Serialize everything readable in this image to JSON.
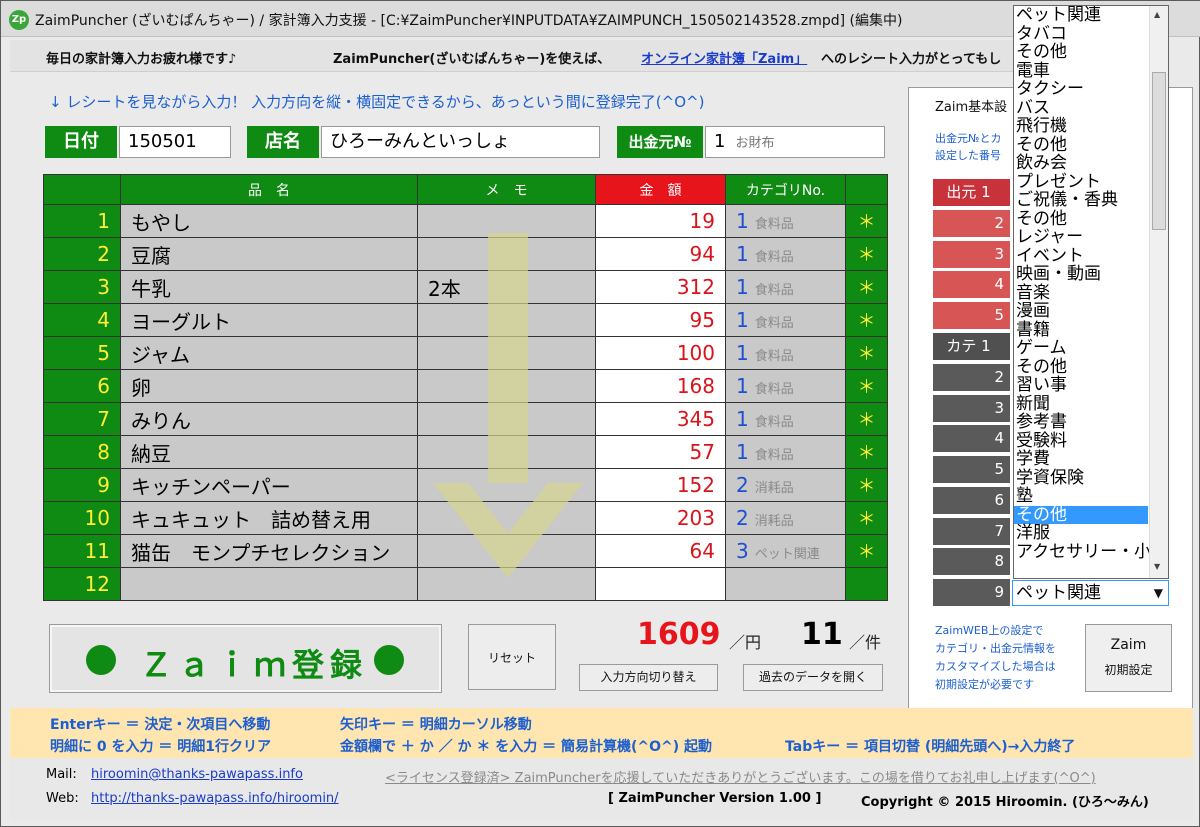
{
  "window": {
    "icon_text": "Zp",
    "title": "ZaimPuncher (ざいむぱんちゃー) / 家計簿入力支援 - [C:¥ZaimPuncher¥INPUTDATA¥ZAIMPUNCH_150502143528.zmpd] (編集中)"
  },
  "banner": {
    "greeting": "毎日の家計簿入力お疲れ様です♪",
    "msg1": "ZaimPuncher(ざいむぱんちゃー)を使えば、",
    "link": "オンライン家計簿「Zaim」",
    "msg2": "へのレシート入力がとってもし"
  },
  "lead": "↓ レシートを見ながら入力！ 入力方向を縦・横固定できるから、あっという間に登録完了(^O^)",
  "header_fields": {
    "date_label": "日付",
    "date_value": "150501",
    "shop_label": "店名",
    "shop_value": "ひろーみんといっしょ",
    "source_label": "出金元№",
    "source_no": "1",
    "source_name": "お財布"
  },
  "table": {
    "columns": [
      "品　名",
      "メ　モ",
      "金　額",
      "カテゴリNo."
    ],
    "rows": [
      {
        "no": "1",
        "name": "もやし",
        "memo": "",
        "amount": "19",
        "cat_no": "1",
        "cat_name": "食料品",
        "mark": "＊"
      },
      {
        "no": "2",
        "name": "豆腐",
        "memo": "",
        "amount": "94",
        "cat_no": "1",
        "cat_name": "食料品",
        "mark": "＊"
      },
      {
        "no": "3",
        "name": "牛乳",
        "memo": "2本",
        "amount": "312",
        "cat_no": "1",
        "cat_name": "食料品",
        "mark": "＊"
      },
      {
        "no": "4",
        "name": "ヨーグルト",
        "memo": "",
        "amount": "95",
        "cat_no": "1",
        "cat_name": "食料品",
        "mark": "＊"
      },
      {
        "no": "5",
        "name": "ジャム",
        "memo": "",
        "amount": "100",
        "cat_no": "1",
        "cat_name": "食料品",
        "mark": "＊"
      },
      {
        "no": "6",
        "name": "卵",
        "memo": "",
        "amount": "168",
        "cat_no": "1",
        "cat_name": "食料品",
        "mark": "＊"
      },
      {
        "no": "7",
        "name": "みりん",
        "memo": "",
        "amount": "345",
        "cat_no": "1",
        "cat_name": "食料品",
        "mark": "＊"
      },
      {
        "no": "8",
        "name": "納豆",
        "memo": "",
        "amount": "57",
        "cat_no": "1",
        "cat_name": "食料品",
        "mark": "＊"
      },
      {
        "no": "9",
        "name": "キッチンペーパー",
        "memo": "",
        "amount": "152",
        "cat_no": "2",
        "cat_name": "消耗品",
        "mark": "＊"
      },
      {
        "no": "10",
        "name": "キュキュット　詰め替え用",
        "memo": "",
        "amount": "203",
        "cat_no": "2",
        "cat_name": "消耗品",
        "mark": "＊"
      },
      {
        "no": "11",
        "name": "猫缶　モンプチセレクション",
        "memo": "",
        "amount": "64",
        "cat_no": "3",
        "cat_name": "ペット関連",
        "mark": "＊"
      },
      {
        "no": "12",
        "name": "",
        "memo": "",
        "amount": "",
        "cat_no": "",
        "cat_name": "",
        "mark": ""
      }
    ]
  },
  "actions": {
    "register": "Ｚａｉｍ登録",
    "reset": "リセット",
    "toggle_direction": "入力方向切り替え",
    "open_past": "過去のデータを開く"
  },
  "totals": {
    "amount": "1609",
    "amount_unit": "／円",
    "count": "11",
    "count_unit": "／件"
  },
  "right_panel": {
    "title": "Zaim基本設",
    "note1": "出金元№とカ",
    "note2": "設定した番号",
    "source_head": "出元 1",
    "source_rows": [
      "2",
      "3",
      "4",
      "5"
    ],
    "cat_head": "カテ 1",
    "cat_rows": [
      "2",
      "3",
      "4",
      "5",
      "6",
      "7",
      "8",
      "9"
    ],
    "foot1": "ZaimWEB上の設定で",
    "foot2": "カテゴリ・出金元情報を",
    "foot3": "カスタマイズした場合は",
    "foot4": "初期設定が必要です",
    "init_btn_line1": "Zaim",
    "init_btn_line2": "初期設定",
    "combo_value": "ペット関連"
  },
  "dropdown": {
    "items": [
      "ペット関連",
      "タバコ",
      "その他",
      "電車",
      "タクシー",
      "バス",
      "飛行機",
      "その他",
      "飲み会",
      "プレゼント",
      "ご祝儀・香典",
      "その他",
      "レジャー",
      "イベント",
      "映画・動画",
      "音楽",
      "漫画",
      "書籍",
      "ゲーム",
      "その他",
      "習い事",
      "新聞",
      "参考書",
      "受験料",
      "学費",
      "学資保険",
      "塾",
      "その他",
      "洋服",
      "アクセサリー・小物"
    ],
    "selected_index": 27
  },
  "help": {
    "line1a": "Enterキー ＝ 決定・次項目へ移動",
    "line1b": "矢印キー ＝ 明細カーソル移動",
    "line2a": "明細に 0 を入力 ＝ 明細1行クリア",
    "line2b": "金額欄で ＋ か ／ か ＊ を入力 ＝ 簡易計算機(^O^) 起動",
    "line2c": "Tabキー ＝ 項目切替 (明細先頭へ)→入力終了"
  },
  "footer": {
    "mail_label": "Mail:",
    "mail": "hiroomin@thanks-pawapass.info",
    "web_label": "Web:",
    "web": "http://thanks-pawapass.info/hiroomin/",
    "license": "<ライセンス登録済> ZaimPuncherを応援していただきありがとうございます。この場を借りてお礼申し上げます(^O^)",
    "version": "[ ZaimPuncher Version 1.00 ]",
    "copyright": "Copyright © 2015 Hiroomin. (ひろ～みん)"
  }
}
